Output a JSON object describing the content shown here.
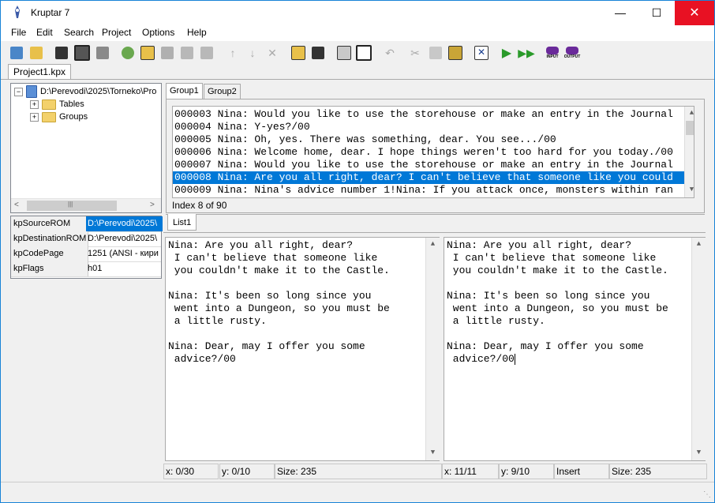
{
  "window": {
    "title": "Kruptar 7"
  },
  "menu": [
    "File",
    "Edit",
    "Search",
    "Project",
    "Options",
    "Help"
  ],
  "toolbar_icons": [
    "new-project-icon",
    "open-icon",
    "save-icon",
    "save-all-icon",
    "close-project-icon",
    "add-rom-icon",
    "open-folder-icon",
    "disabled-save-icon",
    "disabled-copy-icon",
    "disabled-doc-icon",
    "move-up-icon",
    "move-down-icon",
    "delete-icon",
    "import-icon",
    "save-rom-icon",
    "insert-icon",
    "replace-icon",
    "undo-icon",
    "cut-icon",
    "copy-icon",
    "paste-icon",
    "clear-icon",
    "run-icon",
    "run-all-icon",
    "input-icon",
    "output-icon"
  ],
  "toolbar_labels": {
    "input": "INPUT",
    "output": "OUTPUT"
  },
  "project_tab": "Project1.kpx",
  "tree": {
    "root": "D:\\Perevodi\\2025\\Torneko\\Pro",
    "children": [
      "Tables",
      "Groups"
    ]
  },
  "properties": [
    {
      "key": "kpSourceROM",
      "value": "D:\\Perevodi\\2025\\"
    },
    {
      "key": "kpDestinationROM",
      "value": "D:\\Perevodi\\2025\\"
    },
    {
      "key": "kpCodePage",
      "value": "1251  (ANSI - кири"
    },
    {
      "key": "kpFlags",
      "value": "h01"
    }
  ],
  "group_tabs": [
    "Group1",
    "Group2"
  ],
  "list_items": [
    "000003 Nina: Would you like to use the storehouse or make an entry in the Journal",
    "000004 Nina: Y-yes?/00",
    "000005 Nina: Oh, yes. There was something, dear. You see.../00",
    "000006 Nina: Welcome home, dear. I hope things weren't too hard for you today./00",
    "000007 Nina: Would you like to use the storehouse or make an entry in the Journal",
    "000008 Nina: Are you all right, dear? I can't believe that someone like you could",
    "000009 Nina: Nina's advice number 1!Nina: If you attack once, monsters within ran"
  ],
  "selected_index": 5,
  "index_label": "Index 8 of 90",
  "list_tab": "List1",
  "editor_left": "Nina: Are you all right, dear?\n I can't believe that someone like\n you couldn't make it to the Castle.\n\nNina: It's been so long since you\n went into a Dungeon, so you must be\n a little rusty.\n\nNina: Dear, may I offer you some\n advice?/00",
  "editor_right": "Nina: Are you all right, dear?\n I can't believe that someone like\n you couldn't make it to the Castle.\n\nNina: It's been so long since you\n went into a Dungeon, so you must be\n a little rusty.\n\nNina: Dear, may I offer you some\n advice?/00",
  "status_left": {
    "x": "x: 0/30",
    "y": "y: 0/10",
    "size": "Size: 235"
  },
  "status_right": {
    "x": "x: 11/11",
    "y": "y: 9/10",
    "mode": "Insert",
    "size": "Size: 235"
  },
  "colors": {
    "selection": "#0078d7",
    "close_button": "#e81123",
    "window_border": "#1883d7"
  }
}
